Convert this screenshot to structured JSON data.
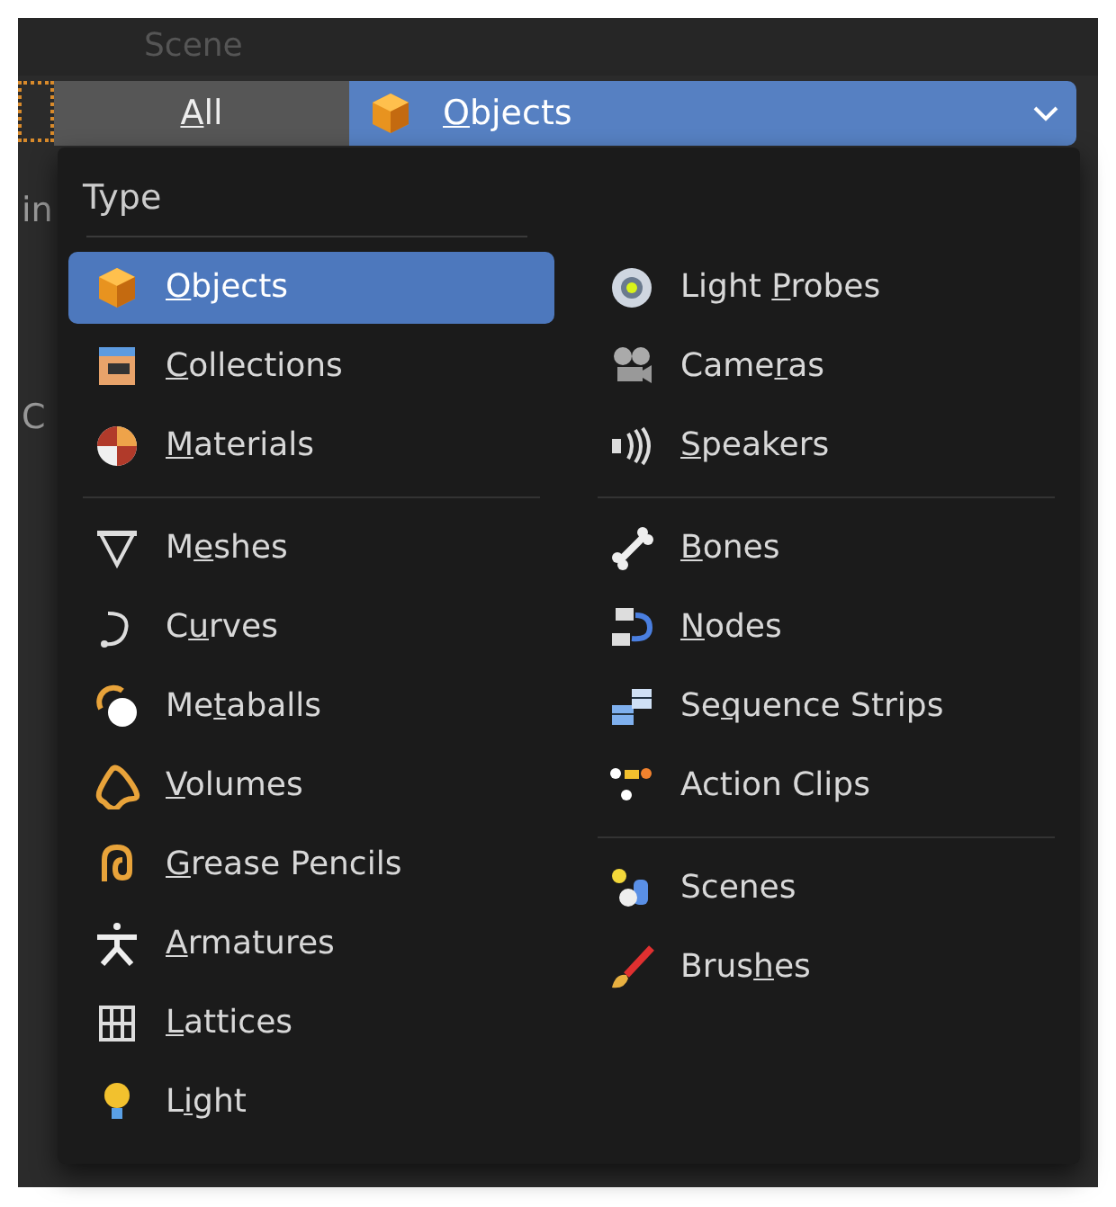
{
  "background": {
    "panel_title": "Scene",
    "left_texts": [
      "in",
      "C"
    ]
  },
  "selector": {
    "all_button": {
      "key": "A",
      "after": "ll"
    },
    "dropdown": {
      "key": "O",
      "after": "bjects"
    }
  },
  "menu": {
    "header": "Type",
    "columns": [
      [
        [
          {
            "key": "O",
            "after": "bjects",
            "selected": true
          },
          {
            "key": "C",
            "after": "ollections",
            "selected": false
          },
          {
            "key": "M",
            "after": "aterials",
            "selected": false
          }
        ],
        [
          {
            "before": "M",
            "key": "e",
            "after": "shes",
            "selected": false
          },
          {
            "before": "C",
            "key": "u",
            "after": "rves",
            "selected": false
          },
          {
            "before": "Me",
            "key": "t",
            "after": "aballs",
            "selected": false
          },
          {
            "key": "V",
            "after": "olumes",
            "selected": false
          },
          {
            "key": "G",
            "after": "rease Pencils",
            "selected": false
          },
          {
            "key": "A",
            "after": "rmatures",
            "selected": false
          },
          {
            "key": "L",
            "after": "attices",
            "selected": false
          },
          {
            "before": "L",
            "key": "i",
            "after": "ght",
            "selected": false
          }
        ]
      ],
      [
        [
          {
            "before": "Light ",
            "key": "P",
            "after": "robes",
            "selected": false
          },
          {
            "before": "Came",
            "key": "r",
            "after": "as",
            "selected": false
          },
          {
            "key": "S",
            "after": "peakers",
            "selected": false
          }
        ],
        [
          {
            "key": "B",
            "after": "ones",
            "selected": false
          },
          {
            "key": "N",
            "after": "odes",
            "selected": false
          },
          {
            "before": "Se",
            "key": "q",
            "after": "uence Strips",
            "selected": false
          },
          {
            "before": "Action Clips",
            "selected": false
          }
        ],
        [
          {
            "before": "Scenes",
            "selected": false
          },
          {
            "before": "Brus",
            "key": "h",
            "after": "es",
            "selected": false
          }
        ]
      ]
    ]
  }
}
